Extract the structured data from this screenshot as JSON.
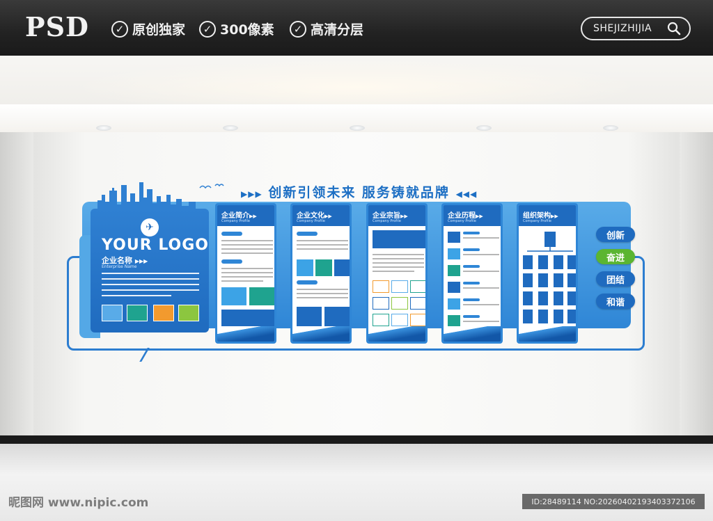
{
  "banner": {
    "brand": "PSD",
    "features": [
      {
        "icon": "check-circle-icon",
        "label": "原创独家"
      },
      {
        "icon": "check-circle-icon",
        "label": "300像素"
      },
      {
        "icon": "check-circle-icon",
        "label": "高清分层"
      }
    ],
    "search_label": "SHEJIZHIJIA",
    "search_icon": "search-icon"
  },
  "board": {
    "slogan": "创新引领未来 服务铸就品牌",
    "slogan_arrows_left": "▶▶▶",
    "slogan_arrows_right": "◀◀◀",
    "logo_title": "YOUR LOGO",
    "company_name": "企业名称",
    "company_name_arrows": "▶▶▶",
    "company_name_en": "Enterprise Name",
    "panels": [
      {
        "title": "企业简介",
        "arrows": "▶▶",
        "subtitle": "Company Profile"
      },
      {
        "title": "企业文化",
        "arrows": "▶▶",
        "subtitle": "Company Profile"
      },
      {
        "title": "企业宗旨",
        "arrows": "▶▶",
        "subtitle": "Company Profile"
      },
      {
        "title": "企业历程",
        "arrows": "▶▶",
        "subtitle": "Company Profile"
      },
      {
        "title": "组织架构",
        "arrows": "▶▶",
        "subtitle": "Company Profile"
      }
    ],
    "values": [
      {
        "label": "创新",
        "color": "#1f6bbf"
      },
      {
        "label": "奋进",
        "color": "#5bb531"
      },
      {
        "label": "团结",
        "color": "#1f6bbf"
      },
      {
        "label": "和谐",
        "color": "#1f6bbf"
      }
    ],
    "colors": {
      "primary": "#1f6bbf",
      "light": "#59abe8",
      "teal": "#1fa38f",
      "orange": "#f29a2e",
      "green": "#8cc63f"
    }
  },
  "watermark": {
    "left": "昵图网 www.nipic.com",
    "right": "ID:28489114 NO:20260402193403372106"
  }
}
